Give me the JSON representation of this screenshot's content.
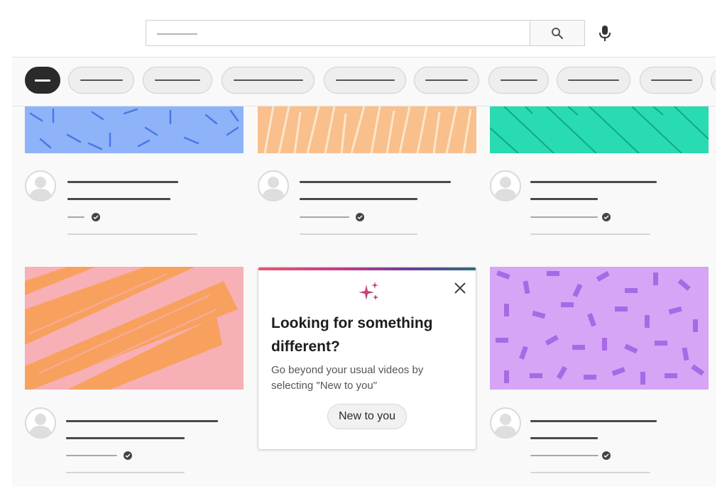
{
  "promo": {
    "title": "Looking for something different?",
    "description": "Go beyond your usual videos by selecting \"New to you\"",
    "button_label": "New to you",
    "gradient_colors": [
      "#e8566e",
      "#c43a8a",
      "#6a3b9d",
      "#2a6f7a"
    ]
  },
  "icons": {
    "search": "search-icon",
    "mic": "mic-icon",
    "close": "close-icon",
    "sparkle": "sparkle-icon",
    "avatar": "avatar-icon",
    "verified": "verified-check-icon"
  },
  "thumbnail_colors": {
    "blue": "#8fb3f8",
    "orange_stripes": "#f9bf8c",
    "teal": "#29dbb0",
    "pink_brush": "#f7b0b5",
    "purple_confetti": "#d6a5f5"
  }
}
